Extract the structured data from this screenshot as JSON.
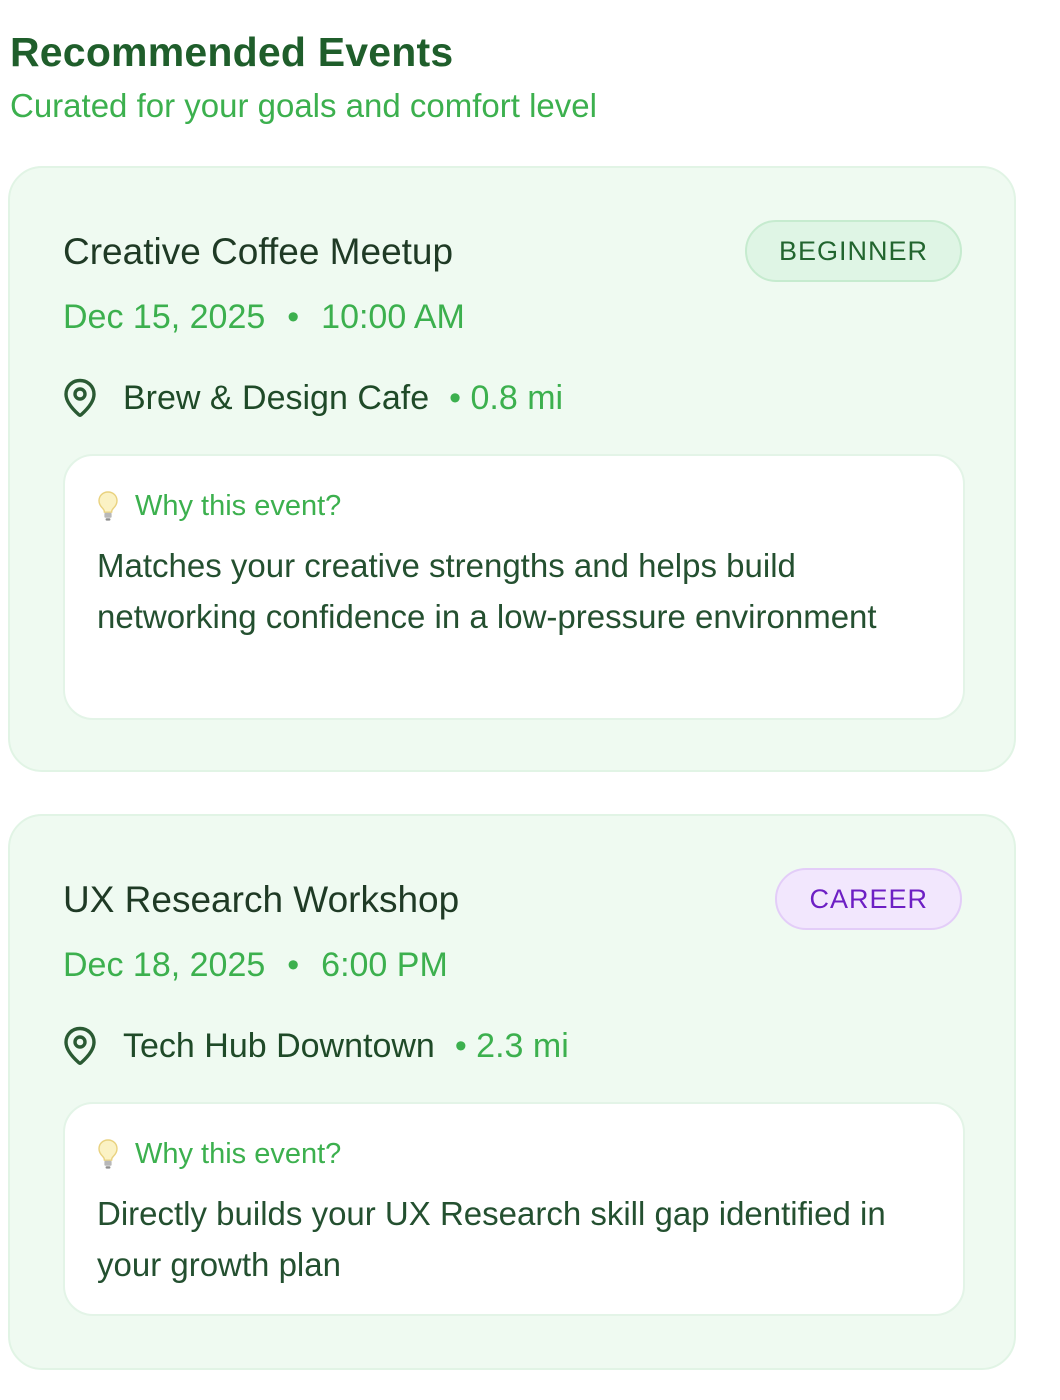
{
  "header": {
    "title": "Recommended Events",
    "subtitle": "Curated for your goals and comfort level"
  },
  "events": [
    {
      "title": "Creative Coffee Meetup",
      "badge": "BEGINNER",
      "date": "Dec 15, 2025",
      "separator": "•",
      "time": "10:00 AM",
      "venue": "Brew & Design Cafe",
      "distance": "• 0.8 mi",
      "why_label": "Why this event?",
      "why_text": "Matches your creative strengths and helps build networking confidence in a low-pressure environment"
    },
    {
      "title": "UX Research Workshop",
      "badge": "CAREER",
      "date": "Dec 18, 2025",
      "separator": "•",
      "time": "6:00 PM",
      "venue": "Tech Hub Downtown",
      "distance": "• 2.3 mi",
      "why_label": "Why this event?",
      "why_text": "Directly builds your UX Research skill gap identified in your growth plan"
    }
  ],
  "icons": {
    "location": "map-pin-icon",
    "why": "lightbulb-icon"
  },
  "colors": {
    "title": "#1f5e2b",
    "accent_green": "#3cb04e",
    "card_bg": "#effaf1",
    "badge_beginner_bg": "#dff5e5",
    "badge_beginner_text": "#22652f",
    "badge_career_bg": "#f2e7fd",
    "badge_career_text": "#6d1fc4"
  }
}
